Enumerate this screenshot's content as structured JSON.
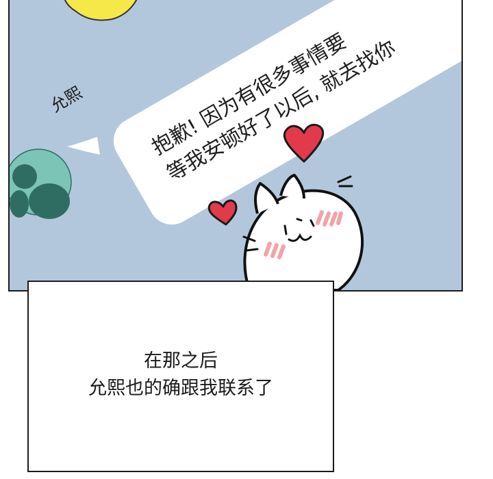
{
  "panel": {
    "sender_name": "允熙",
    "message_line_1": "抱歉! 因为有很多事情要",
    "message_line_2": "等我安顿好了以后, 就去找你",
    "colors": {
      "background": "#b3c7dc",
      "bubble": "#ffffff",
      "avatar": "#7bc4b6",
      "avatar_dark": "#2f6d62",
      "yellow_bubble": "#f7e84a",
      "heart": "#e23a4a",
      "blush": "#f2a3a8"
    }
  },
  "caption": {
    "line_1": "在那之后",
    "line_2": "允熙也的确跟我联系了"
  }
}
